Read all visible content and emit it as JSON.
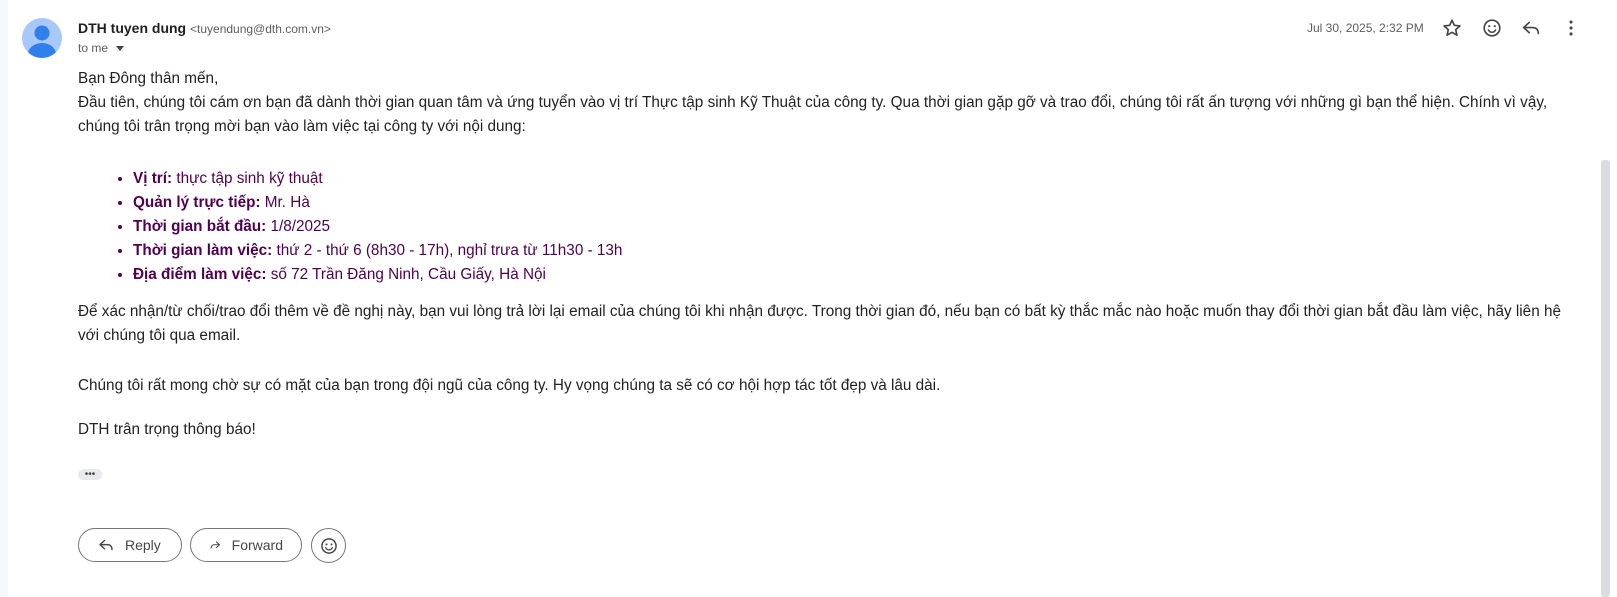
{
  "sender": {
    "name": "DTH tuyen dung",
    "email": "<tuyendung@dth.com.vn>",
    "to_label": "to me",
    "date": "Jul 30, 2025, 2:32 PM"
  },
  "header_icons": [
    "star-icon",
    "emoji-icon",
    "reply-icon",
    "more-vert-icon"
  ],
  "body": {
    "greeting": "Bạn Đông thân mến,",
    "intro": "Đầu tiên, chúng tôi cám ơn bạn đã dành thời gian quan tâm và ứng tuyển vào vị trí Thực tập sinh Kỹ Thuật của công ty. Qua thời gian gặp gỡ và trao đổi, chúng tôi rất ấn tượng với những gì bạn thể hiện. Chính vì vậy, chúng tôi trân trọng mời bạn vào làm việc tại công ty với nội dung:",
    "details": [
      {
        "label": "Vị trí:",
        "value": "thực tập sinh kỹ thuật"
      },
      {
        "label": "Quản lý trực tiếp:",
        "value": "Mr. Hà"
      },
      {
        "label": "Thời gian bắt đầu:",
        "value": "1/8/2025"
      },
      {
        "label": "Thời gian làm việc:",
        "value": "thứ 2 - thứ 6 (8h30 - 17h), nghỉ trưa từ 11h30 - 13h"
      },
      {
        "label": "Địa điểm làm việc:",
        "value": "số 72 Trần Đăng Ninh, Cầu Giấy, Hà Nội"
      }
    ],
    "confirm": "Để xác nhận/từ chối/trao đổi thêm về đề nghị này, bạn vui lòng trả lời lại email của chúng tôi khi nhận được. Trong thời gian đó, nếu bạn có bất kỳ thắc mắc nào hoặc muốn thay đổi thời gian bắt đầu làm việc, hãy liên hệ với chúng tôi qua email.",
    "closing": "Chúng tôi rất mong chờ sự có mặt của bạn trong đội ngũ của công ty. Hy vọng chúng ta sẽ có cơ hội hợp tác tốt đẹp và lâu dài.",
    "signoff": "DTH trân trọng thông báo!"
  },
  "ellipsis": "•••",
  "actions": {
    "reply_label": "Reply",
    "forward_label": "Forward"
  }
}
